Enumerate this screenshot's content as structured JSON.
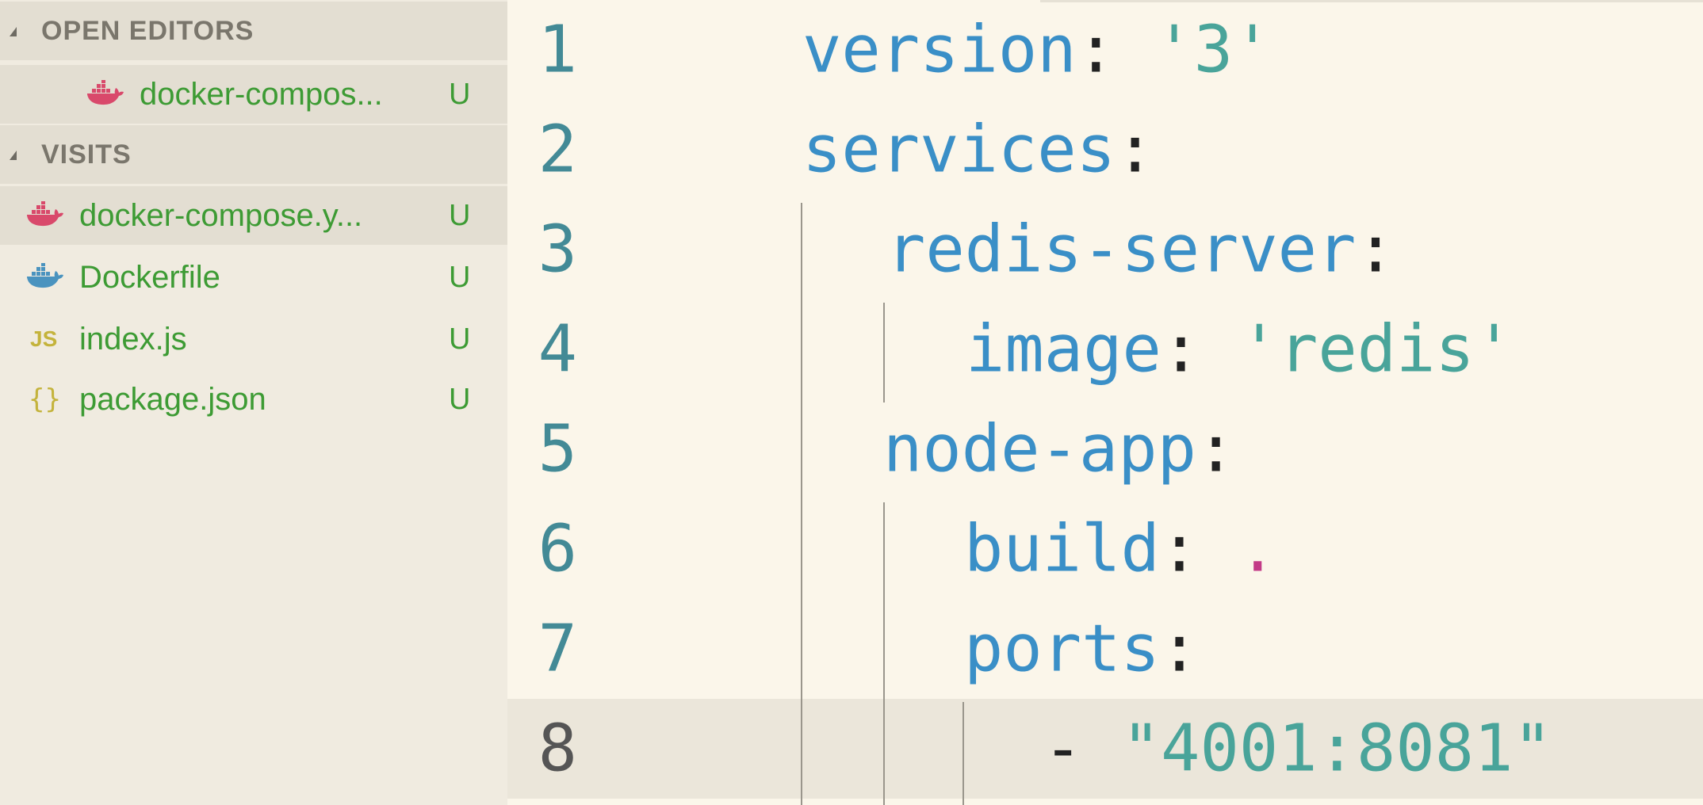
{
  "sidebar": {
    "open_editors": {
      "title": "OPEN EDITORS",
      "items": [
        {
          "name": "docker-compos...",
          "status": "U",
          "icon": "docker-whale-icon-red"
        }
      ]
    },
    "visits": {
      "title": "VISITS",
      "items": [
        {
          "name": "docker-compose.y...",
          "status": "U",
          "icon": "docker-whale-icon-red"
        },
        {
          "name": "Dockerfile",
          "status": "U",
          "icon": "docker-whale-icon-blue"
        },
        {
          "name": "index.js",
          "status": "U",
          "icon": "js-icon",
          "icon_text": "JS"
        },
        {
          "name": "package.json",
          "status": "U",
          "icon": "json-icon",
          "icon_text": "{}"
        }
      ]
    }
  },
  "editor": {
    "lines": [
      {
        "num": "1",
        "key": "version",
        "colon": ":",
        "value": " '3'"
      },
      {
        "num": "2",
        "key": "services",
        "colon": ":",
        "value": ""
      },
      {
        "num": "3",
        "key": "redis-server",
        "colon": ":",
        "value": ""
      },
      {
        "num": "4",
        "key": "image",
        "colon": ":",
        "value": " 'redis'"
      },
      {
        "num": "5",
        "key": "node-app",
        "colon": ":",
        "value": ""
      },
      {
        "num": "6",
        "key": "build",
        "colon": ":",
        "value": " ."
      },
      {
        "num": "7",
        "key": "ports",
        "colon": ":",
        "value": ""
      },
      {
        "num": "8",
        "dash": "- ",
        "value": "\"4001:8081\""
      }
    ]
  },
  "colors": {
    "untracked_green": "#3d9b34",
    "yaml_key_blue": "#3a8fc7",
    "string_teal": "#49a49a",
    "docker_red": "#d9496b",
    "docker_blue": "#4a93bf"
  }
}
